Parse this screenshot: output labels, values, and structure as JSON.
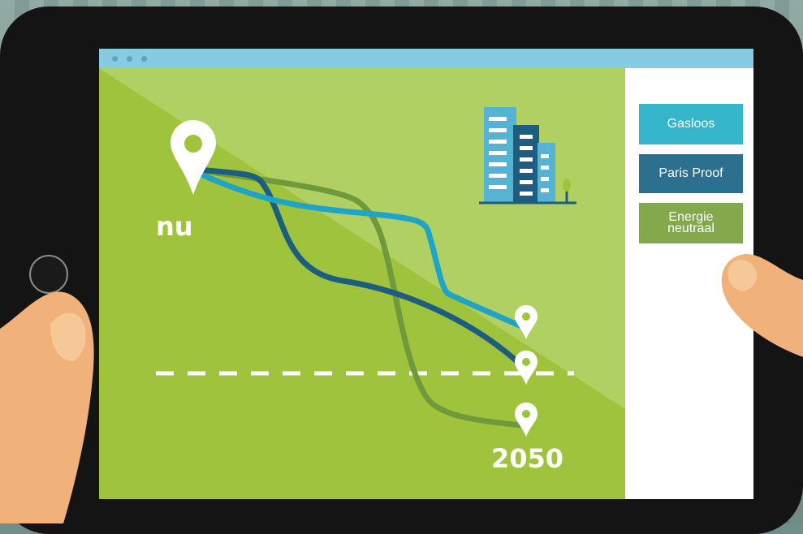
{
  "labels": {
    "start": "nu",
    "end": "2050"
  },
  "legend": {
    "items": [
      {
        "label": "Gasloos",
        "color": "#35b6ca"
      },
      {
        "label": "Paris Proof",
        "color": "#2d6f8f"
      },
      {
        "label": "Energie neutraal",
        "color": "#84a94c"
      }
    ]
  },
  "colors": {
    "tablet": "#141414",
    "canvas": "#9fc33c",
    "canvas_highlight": "#b0d062",
    "browser_bar": "#87cbe0",
    "line_gasloos": "#1fa4c8",
    "line_paris_proof": "#1d5e80",
    "line_energie_neutraal": "#6f9a3b",
    "marker": "#ffffff",
    "skin": "#f0b27a"
  },
  "icons": [
    "location-pin-icon",
    "building-icon",
    "tree-icon"
  ]
}
